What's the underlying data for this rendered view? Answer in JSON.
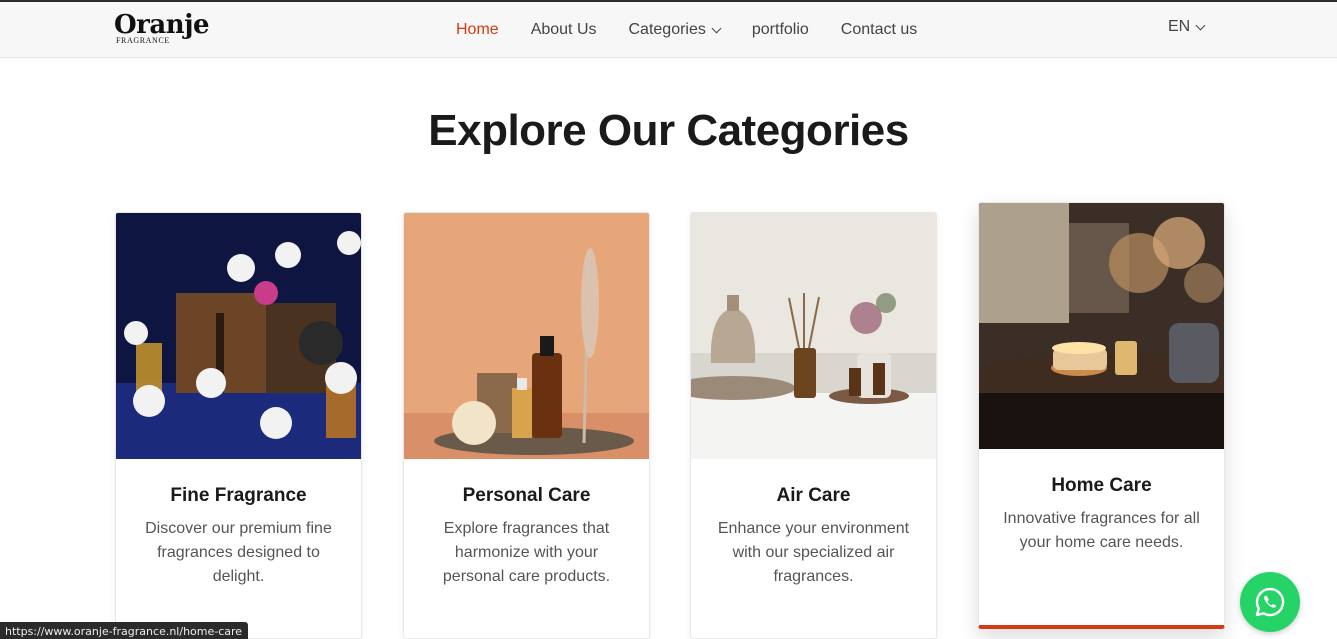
{
  "brand": {
    "name": "Oranje",
    "sub": "FRAGRANCE"
  },
  "nav": {
    "items": [
      {
        "label": "Home",
        "active": true
      },
      {
        "label": "About Us"
      },
      {
        "label": "Categories",
        "has_dropdown": true
      },
      {
        "label": "portfolio"
      },
      {
        "label": "Contact us"
      }
    ],
    "language": "EN"
  },
  "main": {
    "heading": "Explore Our Categories",
    "cards": [
      {
        "title": "Fine Fragrance",
        "description": "Discover our premium fine fragrances designed to delight."
      },
      {
        "title": "Personal Care",
        "description": "Explore fragrances that harmonize with your personal care products."
      },
      {
        "title": "Air Care",
        "description": "Enhance your environment with our specialized air fragrances."
      },
      {
        "title": "Home Care",
        "description": "Innovative fragrances for all your home care needs."
      }
    ]
  },
  "status_url": "https://www.oranje-fragrance.nl/home-care",
  "colors": {
    "accent": "#d63a14",
    "whatsapp": "#25d366"
  },
  "icons": {
    "whatsapp": "whatsapp-icon",
    "dropdown": "chevron-down-icon"
  }
}
